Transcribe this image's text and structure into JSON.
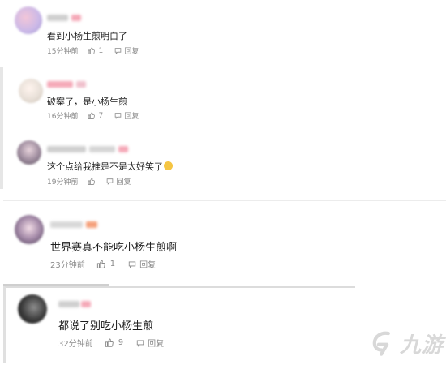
{
  "comments": [
    {
      "text": "看到小杨生煎明白了",
      "time": "15分钟前",
      "likes": "1",
      "reply_label": "回复",
      "avatar_colors": [
        "#c9b8e8",
        "#f3c6d8"
      ]
    },
    {
      "text": "破案了，是小杨生煎",
      "time": "16分钟前",
      "likes": "7",
      "reply_label": "回复",
      "avatar_colors": [
        "#e8e0d8",
        "#f0d7c8"
      ]
    },
    {
      "text": "这个点给我推是不是太好笑了",
      "time": "19分钟前",
      "likes": "",
      "reply_label": "回复",
      "avatar_colors": [
        "#7b6a7e",
        "#e8d4dc"
      ]
    },
    {
      "text": "世界赛真不能吃小杨生煎啊",
      "time": "23分钟前",
      "likes": "1",
      "reply_label": "回复",
      "avatar_colors": [
        "#5e4d66",
        "#f2dce6"
      ]
    },
    {
      "text": "都说了别吃小杨生煎",
      "time": "32分钟前",
      "likes": "9",
      "reply_label": "回复",
      "avatar_colors": [
        "#2a2a2a",
        "#8d8d8d"
      ]
    }
  ],
  "watermark": {
    "text": "九游",
    "icon": "jiuyou-logo-icon",
    "color": "#d2d2d2"
  },
  "colors": {
    "meta": "#8a8a8a",
    "name_pink": "#f5a9b8",
    "name_gray": "#c9c9c9"
  }
}
